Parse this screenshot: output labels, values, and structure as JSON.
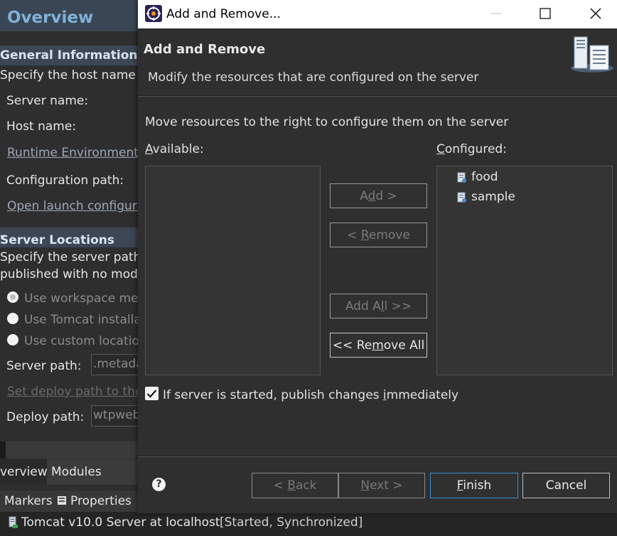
{
  "background_editor": {
    "overview_title": "Overview",
    "general_info_header": "General Information",
    "general_info_desc": "Specify the host name a",
    "server_name_label": "Server name:",
    "host_name_label": "Host name:",
    "runtime_env_link": "Runtime Environment:",
    "config_path_label": "Configuration path:",
    "open_launch_link": "Open launch configura",
    "server_locations_header": "Server Locations",
    "server_locations_desc_1": "Specify the server path",
    "server_locations_desc_2": "published with no modu",
    "radio_workspace": "Use workspace met",
    "radio_tomcat": "Use Tomcat installa",
    "radio_custom": "Use custom locatio",
    "server_path_label": "Server path:",
    "server_path_value": ".metada",
    "set_deploy_link": "Set deploy path to the",
    "deploy_path_label": "Deploy path:",
    "deploy_path_value": "wtpweb",
    "tab_overview": "verview",
    "tab_modules": "Modules",
    "markers_tab": "Markers",
    "properties_tab": "Properties"
  },
  "status_bar": {
    "server": "Tomcat v10.0 Server at localhost",
    "state": "[Started, Synchronized]"
  },
  "dialog": {
    "title": "Add and Remove...",
    "banner_title": "Add and Remove",
    "banner_subtitle": "Modify the resources that are configured on the server",
    "instruction": "Move resources to the right to configure them on the server",
    "available_label": "Available:",
    "configured_label": "Configured:",
    "available_items": [],
    "configured_items": [
      "food",
      "sample"
    ],
    "buttons": {
      "add": "Add >",
      "remove": "< Remove",
      "add_all": "Add All >>",
      "remove_all": "<< Remove All"
    },
    "publish_checkbox_label": "If server is started, publish changes immediately",
    "publish_checked": true,
    "footer": {
      "back": "< Back",
      "next": "Next >",
      "finish": "Finish",
      "cancel": "Cancel"
    }
  },
  "colors": {
    "dialog_bg": "#2f2f2f",
    "titlebar_bg": "#ffffff",
    "primary_border": "#3c8fd6",
    "section_header_bg": "#3c4655"
  }
}
